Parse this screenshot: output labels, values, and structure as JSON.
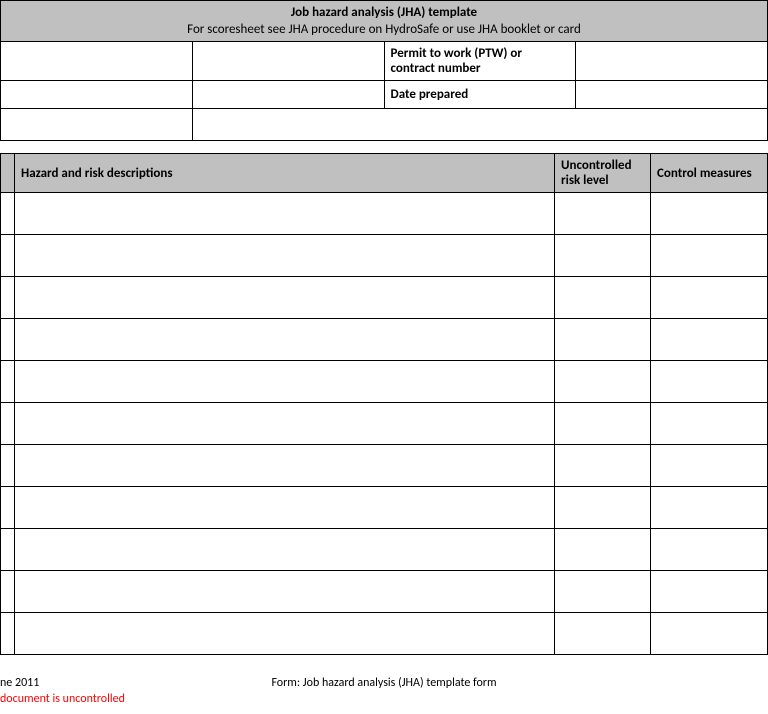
{
  "header": {
    "title": "Job hazard analysis (JHA) template",
    "subtitle": "For scoresheet see JHA procedure on HydroSafe or use JHA booklet or card",
    "permit_label": "Permit to work (PTW) or contract number",
    "permit_value": "",
    "date_label": "Date prepared",
    "date_value": "",
    "blank1": "",
    "desc_value": ""
  },
  "table": {
    "headers": {
      "num": "",
      "hazard": "Hazard and risk descriptions",
      "risk": "Uncontrolled risk level",
      "control": "Control measures"
    },
    "row_count": 11
  },
  "footer": {
    "date_fragment": "ne 2011",
    "form_name": "Form: Job hazard analysis (JHA) template form",
    "warning_fragment": "document is uncontrolled"
  }
}
